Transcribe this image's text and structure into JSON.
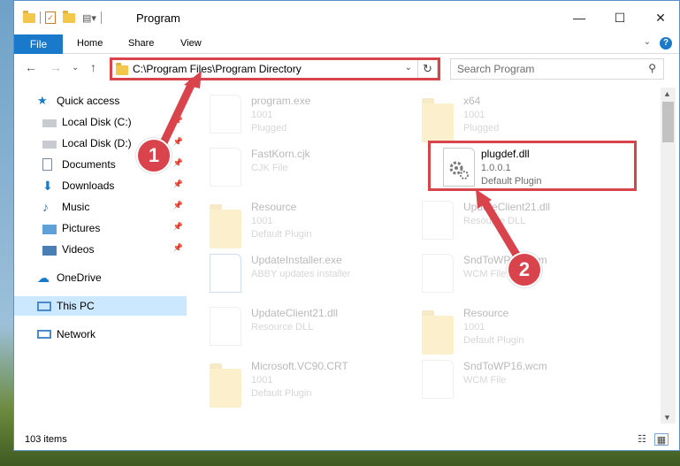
{
  "window": {
    "title": "Program"
  },
  "ribbon": {
    "file": "File",
    "tabs": [
      "Home",
      "Share",
      "View"
    ]
  },
  "nav": {
    "address": "C:\\Program Files\\Program Directory",
    "search_placeholder": "Search Program"
  },
  "sidebar": {
    "items": [
      {
        "label": "Quick access",
        "icon": "star-icon"
      },
      {
        "label": "Local Disk (C:)",
        "icon": "drive-icon"
      },
      {
        "label": "Local Disk (D:)",
        "icon": "drive-icon"
      },
      {
        "label": "Documents",
        "icon": "documents-icon"
      },
      {
        "label": "Downloads",
        "icon": "download-icon"
      },
      {
        "label": "Music",
        "icon": "music-icon"
      },
      {
        "label": "Pictures",
        "icon": "pictures-icon"
      },
      {
        "label": "Videos",
        "icon": "videos-icon"
      },
      {
        "label": "OneDrive",
        "icon": "cloud-icon"
      },
      {
        "label": "This PC",
        "icon": "computer-icon"
      },
      {
        "label": "Network",
        "icon": "network-icon"
      }
    ]
  },
  "files": [
    {
      "name": "program.exe",
      "sub1": "1001",
      "sub2": "Plugged",
      "kind": "exe"
    },
    {
      "name": "x64",
      "sub1": "1001",
      "sub2": "Plugged",
      "kind": "folder"
    },
    {
      "name": "FastKorn.cjk",
      "sub1": "CJK File",
      "sub2": "",
      "kind": "doc"
    },
    {
      "name": "plugdef.dll",
      "sub1": "1.0.0.1",
      "sub2": "Default Plugin",
      "kind": "dll"
    },
    {
      "name": "Resource",
      "sub1": "1001",
      "sub2": "Default Plugin",
      "kind": "folder"
    },
    {
      "name": "UpdateClient21.dll",
      "sub1": "Resource DLL",
      "sub2": "",
      "kind": "dll"
    },
    {
      "name": "UpdateInstaller.exe",
      "sub1": "ABBY updates installer",
      "sub2": "",
      "kind": "exe"
    },
    {
      "name": "SndToWP16.wcm",
      "sub1": "WCM File",
      "sub2": "",
      "kind": "doc"
    },
    {
      "name": "UpdateClient21.dll",
      "sub1": "Resource DLL",
      "sub2": "",
      "kind": "dll"
    },
    {
      "name": "Resource",
      "sub1": "1001",
      "sub2": "Default Plugin",
      "kind": "folder"
    },
    {
      "name": "Microsoft.VC90.CRT",
      "sub1": "1001",
      "sub2": "Default Plugin",
      "kind": "folder"
    },
    {
      "name": "SndToWP16.wcm",
      "sub1": "WCM File",
      "sub2": "",
      "kind": "doc"
    }
  ],
  "status": {
    "items": "103 items"
  },
  "callouts": {
    "one": "1",
    "two": "2"
  },
  "colors": {
    "accent": "#1979ca",
    "highlight": "#d9434b",
    "selected": "#cce8ff"
  }
}
